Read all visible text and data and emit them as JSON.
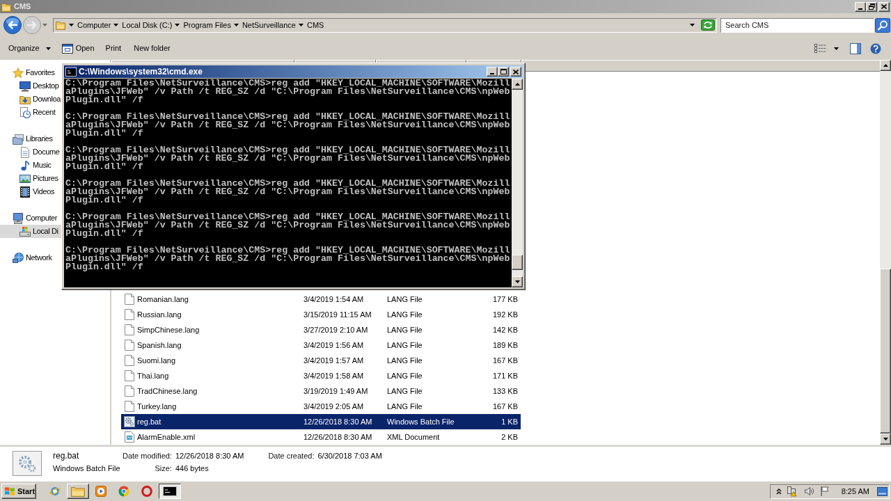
{
  "explorer": {
    "title": "CMS",
    "active": false,
    "breadcrumb": [
      "Computer",
      "Local Disk (C:)",
      "Program Files",
      "NetSurveillance",
      "CMS"
    ],
    "search": {
      "placeholder": "Search CMS"
    },
    "toolbar": [
      {
        "label": "Organize",
        "kind": "menu"
      },
      {
        "label": "Open",
        "kind": "icon"
      },
      {
        "label": "Print",
        "kind": "plain"
      },
      {
        "label": "New folder",
        "kind": "plain"
      }
    ],
    "sidebar": [
      {
        "label": "Favorites",
        "selected": false,
        "children": [
          {
            "label": "Desktop",
            "selected": false
          },
          {
            "label": "Downloa",
            "selected": false
          },
          {
            "label": "Recent",
            "selected": false
          }
        ]
      },
      {
        "label": "Libraries",
        "selected": false,
        "children": [
          {
            "label": "Docume",
            "selected": false
          },
          {
            "label": "Music",
            "selected": false
          },
          {
            "label": "Pictures",
            "selected": false
          },
          {
            "label": "Videos",
            "selected": false
          }
        ]
      },
      {
        "label": "Computer",
        "selected": false,
        "children": [
          {
            "label": "Local Di",
            "selected": true
          }
        ]
      },
      {
        "label": "Network",
        "selected": false
      }
    ],
    "files": [
      {
        "name": "Romanian.lang",
        "date": "3/4/2019 1:54 AM",
        "type": "LANG File",
        "size": "177 KB",
        "kind": "lang",
        "selected": false
      },
      {
        "name": "Russian.lang",
        "date": "3/15/2019 11:15 AM",
        "type": "LANG File",
        "size": "192 KB",
        "kind": "lang",
        "selected": false
      },
      {
        "name": "SimpChinese.lang",
        "date": "3/27/2019 2:10 AM",
        "type": "LANG File",
        "size": "142 KB",
        "kind": "lang",
        "selected": false
      },
      {
        "name": "Spanish.lang",
        "date": "3/4/2019 1:56 AM",
        "type": "LANG File",
        "size": "189 KB",
        "kind": "lang",
        "selected": false
      },
      {
        "name": "Suomi.lang",
        "date": "3/4/2019 1:57 AM",
        "type": "LANG File",
        "size": "167 KB",
        "kind": "lang",
        "selected": false
      },
      {
        "name": "Thai.lang",
        "date": "3/4/2019 1:58 AM",
        "type": "LANG File",
        "size": "171 KB",
        "kind": "lang",
        "selected": false
      },
      {
        "name": "TradChinese.lang",
        "date": "3/19/2019 1:49 AM",
        "type": "LANG File",
        "size": "133 KB",
        "kind": "lang",
        "selected": false
      },
      {
        "name": "Turkey.lang",
        "date": "3/4/2019 2:05 AM",
        "type": "LANG File",
        "size": "167 KB",
        "kind": "lang",
        "selected": false
      },
      {
        "name": "reg.bat",
        "date": "12/26/2018 8:30 AM",
        "type": "Windows Batch File",
        "size": "1 KB",
        "kind": "batch",
        "selected": true
      },
      {
        "name": "AlarmEnable.xml",
        "date": "12/26/2018 8:30 AM",
        "type": "XML Document",
        "size": "2 KB",
        "kind": "xml",
        "selected": false
      }
    ],
    "details": {
      "name": "reg.bat",
      "type": "Windows Batch File",
      "fields": [
        {
          "label": "Date modified:",
          "value": "12/26/2018 8:30 AM"
        },
        {
          "label": "Date created:",
          "value": "6/30/2018 7:03 AM"
        },
        {
          "label": "Size:",
          "value": "446 bytes"
        }
      ]
    }
  },
  "console": {
    "title": "C:\\Windows\\system32\\cmd.exe",
    "active": true,
    "lines": [
      "C:\\Program Files\\NetSurveillance\\CMS>reg add \"HKEY_LOCAL_MACHINE\\SOFTWARE\\MozillaPlugins\\JFWeb\" /v Path /t REG_SZ /d \"C:\\Program Files\\NetSurveillance\\CMS\\npWebPlugin.dll\" /f",
      "C:\\Program Files\\NetSurveillance\\CMS>reg add \"HKEY_LOCAL_MACHINE\\SOFTWARE\\MozillaPlugins\\JFWeb\" /v Path /t REG_SZ /d \"C:\\Program Files\\NetSurveillance\\CMS\\npWebPlugin.dll\" /f",
      "C:\\Program Files\\NetSurveillance\\CMS>reg add \"HKEY_LOCAL_MACHINE\\SOFTWARE\\MozillaPlugins\\JFWeb\" /v Path /t REG_SZ /d \"C:\\Program Files\\NetSurveillance\\CMS\\npWebPlugin.dll\" /f",
      "C:\\Program Files\\NetSurveillance\\CMS>reg add \"HKEY_LOCAL_MACHINE\\SOFTWARE\\MozillaPlugins\\JFWeb\" /v Path /t REG_SZ /d \"C:\\Program Files\\NetSurveillance\\CMS\\npWebPlugin.dll\" /f",
      "C:\\Program Files\\NetSurveillance\\CMS>reg add \"HKEY_LOCAL_MACHINE\\SOFTWARE\\MozillaPlugins\\JFWeb\" /v Path /t REG_SZ /d \"C:\\Program Files\\NetSurveillance\\CMS\\npWebPlugin.dll\" /f",
      "C:\\Program Files\\NetSurveillance\\CMS>reg add \"HKEY_LOCAL_MACHINE\\SOFTWARE\\MozillaPlugins\\JFWeb\" /v Path /t REG_SZ /d \"C:\\Program Files\\NetSurveillance\\CMS\\npWebPlugin.dll\" /f"
    ]
  },
  "taskbar": {
    "start": "Start",
    "apps": [
      {
        "running": false,
        "selected": false
      },
      {
        "running": true,
        "selected": false
      },
      {
        "running": false,
        "selected": false
      },
      {
        "running": false,
        "selected": false
      },
      {
        "running": false,
        "selected": false
      },
      {
        "running": true,
        "selected": true
      }
    ],
    "clock": "8:25 AM"
  }
}
